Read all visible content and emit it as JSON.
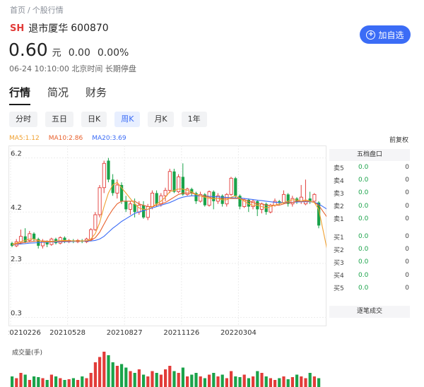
{
  "breadcrumb": {
    "home": "首页",
    "sep": "/",
    "current": "个股行情"
  },
  "stock": {
    "market": "SH",
    "name": "退市厦华",
    "code": "600870",
    "price": "0.60",
    "unit": "元",
    "change": "0.00",
    "change_pct": "0.00%"
  },
  "status": {
    "time": "06-24 10:10:00",
    "zone": "北京时间",
    "state": "长期停盘"
  },
  "watchlist_button": {
    "label": "加自选",
    "icon": "plus-circle-icon"
  },
  "main_tabs": [
    {
      "label": "行情",
      "active": true
    },
    {
      "label": "简况",
      "active": false
    },
    {
      "label": "财务",
      "active": false
    }
  ],
  "period_tabs": [
    {
      "label": "分时",
      "active": false
    },
    {
      "label": "五日",
      "active": false
    },
    {
      "label": "日K",
      "active": false
    },
    {
      "label": "周K",
      "active": true
    },
    {
      "label": "月K",
      "active": false
    },
    {
      "label": "1年",
      "active": false
    }
  ],
  "ma_legend": [
    {
      "label": "MA5:1.12",
      "color": "#f0a030"
    },
    {
      "label": "MA10:2.86",
      "color": "#e8602c"
    },
    {
      "label": "MA20:3.69",
      "color": "#3b6cf6"
    }
  ],
  "fq_label": "前复权",
  "colors": {
    "up": "#e23c39",
    "down": "#1aa34a",
    "accent": "#3b6cf6"
  },
  "order_book": {
    "title": "五档盘口",
    "sells": [
      {
        "label": "卖5",
        "price": "0.0",
        "volume": "0"
      },
      {
        "label": "卖4",
        "price": "0.0",
        "volume": "0"
      },
      {
        "label": "卖3",
        "price": "0.0",
        "volume": "0"
      },
      {
        "label": "卖2",
        "price": "0.0",
        "volume": "0"
      },
      {
        "label": "卖1",
        "price": "0.0",
        "volume": "0"
      }
    ],
    "buys": [
      {
        "label": "买1",
        "price": "0.0",
        "volume": "0"
      },
      {
        "label": "买2",
        "price": "0.0",
        "volume": "0"
      },
      {
        "label": "买3",
        "price": "0.0",
        "volume": "0"
      },
      {
        "label": "买4",
        "price": "0.0",
        "volume": "0"
      },
      {
        "label": "买5",
        "price": "0.0",
        "volume": "0"
      }
    ]
  },
  "trades_title": "逐笔成交",
  "volume_label": "成交量(手)",
  "chart_data": {
    "type": "candlestick",
    "y_ticks": [
      "6.2",
      "4.2",
      "2.3",
      "0.3"
    ],
    "y_tick_values": [
      6.2,
      4.2,
      2.3,
      0.3
    ],
    "ylim": [
      0.0,
      6.4
    ],
    "x_ticks": [
      "20210226",
      "20210528",
      "20210827",
      "20211126",
      "20220304"
    ],
    "x_tick_index": [
      0,
      13,
      26,
      39,
      52
    ],
    "candles": [
      {
        "o": 3.05,
        "c": 2.95,
        "h": 3.1,
        "l": 2.9
      },
      {
        "o": 2.95,
        "c": 3.1,
        "h": 3.2,
        "l": 2.9
      },
      {
        "o": 3.1,
        "c": 3.3,
        "h": 3.55,
        "l": 3.0
      },
      {
        "o": 3.3,
        "c": 3.1,
        "h": 3.6,
        "l": 3.05
      },
      {
        "o": 3.15,
        "c": 3.4,
        "h": 3.5,
        "l": 3.1
      },
      {
        "o": 3.4,
        "c": 3.2,
        "h": 3.45,
        "l": 3.1
      },
      {
        "o": 3.2,
        "c": 2.95,
        "h": 3.25,
        "l": 2.85
      },
      {
        "o": 2.95,
        "c": 3.1,
        "h": 3.2,
        "l": 2.85
      },
      {
        "o": 3.1,
        "c": 3.0,
        "h": 3.15,
        "l": 2.9
      },
      {
        "o": 3.0,
        "c": 3.2,
        "h": 3.25,
        "l": 2.95
      },
      {
        "o": 3.2,
        "c": 3.05,
        "h": 3.25,
        "l": 3.0
      },
      {
        "o": 3.05,
        "c": 3.25,
        "h": 3.3,
        "l": 3.0
      },
      {
        "o": 3.25,
        "c": 3.1,
        "h": 3.3,
        "l": 3.05
      },
      {
        "o": 3.1,
        "c": 3.15,
        "h": 3.2,
        "l": 3.05
      },
      {
        "o": 3.15,
        "c": 3.1,
        "h": 3.2,
        "l": 3.05
      },
      {
        "o": 3.1,
        "c": 3.15,
        "h": 3.2,
        "l": 3.05
      },
      {
        "o": 3.15,
        "c": 3.1,
        "h": 3.2,
        "l": 3.05
      },
      {
        "o": 3.1,
        "c": 3.2,
        "h": 3.25,
        "l": 3.05
      },
      {
        "o": 3.2,
        "c": 3.55,
        "h": 3.6,
        "l": 3.15
      },
      {
        "o": 3.55,
        "c": 4.1,
        "h": 4.2,
        "l": 3.5
      },
      {
        "o": 4.1,
        "c": 5.1,
        "h": 5.2,
        "l": 4.0
      },
      {
        "o": 5.1,
        "c": 6.0,
        "h": 6.1,
        "l": 4.9
      },
      {
        "o": 6.1,
        "c": 5.4,
        "h": 6.2,
        "l": 5.3
      },
      {
        "o": 5.4,
        "c": 4.9,
        "h": 5.6,
        "l": 4.8
      },
      {
        "o": 4.9,
        "c": 5.2,
        "h": 5.4,
        "l": 4.7
      },
      {
        "o": 5.2,
        "c": 4.6,
        "h": 5.3,
        "l": 4.5
      },
      {
        "o": 4.6,
        "c": 4.3,
        "h": 4.8,
        "l": 4.2
      },
      {
        "o": 4.3,
        "c": 4.5,
        "h": 4.6,
        "l": 4.1
      },
      {
        "o": 4.5,
        "c": 4.2,
        "h": 4.7,
        "l": 4.0
      },
      {
        "o": 4.2,
        "c": 4.45,
        "h": 4.6,
        "l": 4.1
      },
      {
        "o": 4.45,
        "c": 4.0,
        "h": 4.6,
        "l": 3.95
      },
      {
        "o": 4.0,
        "c": 4.4,
        "h": 4.5,
        "l": 3.9
      },
      {
        "o": 4.4,
        "c": 4.9,
        "h": 5.0,
        "l": 4.3
      },
      {
        "o": 4.9,
        "c": 4.5,
        "h": 5.0,
        "l": 4.4
      },
      {
        "o": 4.5,
        "c": 4.8,
        "h": 4.9,
        "l": 4.4
      },
      {
        "o": 4.8,
        "c": 5.0,
        "h": 5.1,
        "l": 4.6
      },
      {
        "o": 5.0,
        "c": 5.7,
        "h": 5.8,
        "l": 4.9
      },
      {
        "o": 5.7,
        "c": 4.95,
        "h": 5.8,
        "l": 4.9
      },
      {
        "o": 4.95,
        "c": 5.5,
        "h": 5.6,
        "l": 4.9
      },
      {
        "o": 5.5,
        "c": 4.85,
        "h": 6.0,
        "l": 4.8
      },
      {
        "o": 4.85,
        "c": 5.05,
        "h": 5.1,
        "l": 4.8
      },
      {
        "o": 5.05,
        "c": 4.9,
        "h": 5.1,
        "l": 4.8
      },
      {
        "o": 4.9,
        "c": 4.6,
        "h": 4.95,
        "l": 4.5
      },
      {
        "o": 4.6,
        "c": 4.85,
        "h": 4.95,
        "l": 4.55
      },
      {
        "o": 4.85,
        "c": 4.45,
        "h": 4.9,
        "l": 4.4
      },
      {
        "o": 4.45,
        "c": 4.95,
        "h": 5.0,
        "l": 4.4
      },
      {
        "o": 4.95,
        "c": 4.6,
        "h": 5.0,
        "l": 4.3
      },
      {
        "o": 4.6,
        "c": 4.8,
        "h": 4.9,
        "l": 4.5
      },
      {
        "o": 4.8,
        "c": 4.5,
        "h": 4.85,
        "l": 4.4
      },
      {
        "o": 4.5,
        "c": 4.85,
        "h": 4.9,
        "l": 4.4
      },
      {
        "o": 4.85,
        "c": 5.45,
        "h": 5.5,
        "l": 4.8
      },
      {
        "o": 5.45,
        "c": 4.8,
        "h": 5.5,
        "l": 4.7
      },
      {
        "o": 4.8,
        "c": 4.4,
        "h": 4.85,
        "l": 4.3
      },
      {
        "o": 4.4,
        "c": 4.65,
        "h": 4.7,
        "l": 4.35
      },
      {
        "o": 4.65,
        "c": 4.4,
        "h": 4.7,
        "l": 4.2
      },
      {
        "o": 4.4,
        "c": 4.6,
        "h": 4.65,
        "l": 4.3
      },
      {
        "o": 4.6,
        "c": 4.3,
        "h": 4.65,
        "l": 4.05
      },
      {
        "o": 4.3,
        "c": 4.5,
        "h": 4.55,
        "l": 4.15
      },
      {
        "o": 4.5,
        "c": 4.2,
        "h": 4.55,
        "l": 4.1
      },
      {
        "o": 4.2,
        "c": 4.45,
        "h": 4.5,
        "l": 4.15
      },
      {
        "o": 4.45,
        "c": 4.6,
        "h": 4.7,
        "l": 4.4
      },
      {
        "o": 4.6,
        "c": 4.55,
        "h": 4.65,
        "l": 4.45
      },
      {
        "o": 4.55,
        "c": 4.85,
        "h": 5.0,
        "l": 4.5
      },
      {
        "o": 4.85,
        "c": 4.5,
        "h": 4.9,
        "l": 4.4
      },
      {
        "o": 4.5,
        "c": 4.7,
        "h": 4.8,
        "l": 4.4
      },
      {
        "o": 4.7,
        "c": 4.6,
        "h": 4.75,
        "l": 4.5
      },
      {
        "o": 4.6,
        "c": 4.75,
        "h": 5.2,
        "l": 4.5
      },
      {
        "o": 4.5,
        "c": 4.6,
        "h": 5.4,
        "l": 4.45
      },
      {
        "o": 4.7,
        "c": 4.6,
        "h": 4.95,
        "l": 4.5
      },
      {
        "o": 4.6,
        "c": 4.85,
        "h": 4.9,
        "l": 4.55
      },
      {
        "o": 4.55,
        "c": 3.7,
        "h": 4.6,
        "l": 3.6
      }
    ],
    "tail": [
      {
        "o": 0.25,
        "c": 0.3,
        "h": 0.32,
        "l": 0.24
      },
      {
        "o": 0.3,
        "c": 0.38,
        "h": 0.42,
        "l": 0.28
      },
      {
        "o": 0.38,
        "c": 0.48,
        "h": 0.55,
        "l": 0.36
      },
      {
        "o": 0.48,
        "c": 0.55,
        "h": 0.62,
        "l": 0.45
      },
      {
        "o": 0.5,
        "c": 0.6,
        "h": 0.65,
        "l": 0.48
      }
    ],
    "ma5": [
      3.0,
      3.05,
      3.1,
      3.15,
      3.2,
      3.2,
      3.15,
      3.1,
      3.1,
      3.1,
      3.12,
      3.14,
      3.15,
      3.14,
      3.13,
      3.13,
      3.13,
      3.14,
      3.2,
      3.4,
      3.8,
      4.4,
      4.9,
      5.2,
      5.3,
      5.1,
      4.9,
      4.7,
      4.5,
      4.35,
      4.3,
      4.3,
      4.4,
      4.5,
      4.6,
      4.75,
      4.95,
      5.0,
      5.05,
      5.05,
      5.0,
      4.95,
      4.85,
      4.8,
      4.75,
      4.7,
      4.7,
      4.7,
      4.65,
      4.65,
      4.75,
      4.8,
      4.7,
      4.6,
      4.5,
      4.45,
      4.45,
      4.4,
      4.35,
      4.4,
      4.45,
      4.5,
      4.55,
      4.6,
      4.65,
      4.65,
      4.6,
      4.65,
      4.6,
      4.55,
      4.3,
      2.8,
      1.9,
      1.12
    ],
    "ma10": [
      3.0,
      3.02,
      3.05,
      3.08,
      3.1,
      3.12,
      3.13,
      3.13,
      3.12,
      3.12,
      3.12,
      3.12,
      3.12,
      3.13,
      3.13,
      3.13,
      3.13,
      3.14,
      3.15,
      3.25,
      3.45,
      3.75,
      4.05,
      4.3,
      4.5,
      4.6,
      4.6,
      4.6,
      4.6,
      4.5,
      4.45,
      4.4,
      4.4,
      4.45,
      4.5,
      4.55,
      4.65,
      4.75,
      4.85,
      4.9,
      4.9,
      4.9,
      4.85,
      4.8,
      4.8,
      4.75,
      4.7,
      4.7,
      4.7,
      4.7,
      4.7,
      4.7,
      4.7,
      4.65,
      4.6,
      4.55,
      4.5,
      4.5,
      4.45,
      4.45,
      4.45,
      4.45,
      4.5,
      4.55,
      4.55,
      4.6,
      4.6,
      4.6,
      4.6,
      4.55,
      4.45,
      4.0,
      3.4,
      2.86
    ],
    "ma20": [
      3.0,
      3.01,
      3.02,
      3.03,
      3.05,
      3.06,
      3.07,
      3.08,
      3.08,
      3.09,
      3.09,
      3.1,
      3.1,
      3.11,
      3.11,
      3.12,
      3.12,
      3.12,
      3.13,
      3.15,
      3.2,
      3.3,
      3.45,
      3.6,
      3.72,
      3.85,
      3.95,
      4.05,
      4.15,
      4.2,
      4.25,
      4.3,
      4.35,
      4.4,
      4.45,
      4.5,
      4.55,
      4.62,
      4.7,
      4.75,
      4.78,
      4.8,
      4.8,
      4.8,
      4.8,
      4.78,
      4.77,
      4.76,
      4.75,
      4.74,
      4.73,
      4.72,
      4.72,
      4.7,
      4.68,
      4.66,
      4.64,
      4.62,
      4.6,
      4.58,
      4.56,
      4.55,
      4.55,
      4.55,
      4.56,
      4.57,
      4.58,
      4.58,
      4.58,
      4.56,
      4.5,
      4.3,
      3.95,
      3.69
    ],
    "volume": [
      30,
      25,
      40,
      35,
      20,
      30,
      28,
      25,
      20,
      35,
      30,
      25,
      20,
      22,
      25,
      20,
      30,
      25,
      40,
      70,
      85,
      100,
      90,
      70,
      60,
      65,
      55,
      45,
      40,
      50,
      35,
      30,
      45,
      40,
      35,
      50,
      60,
      45,
      40,
      55,
      30,
      35,
      40,
      30,
      25,
      35,
      40,
      30,
      35,
      25,
      45,
      30,
      28,
      35,
      25,
      30,
      45,
      40,
      30,
      25,
      20,
      25,
      30,
      22,
      28,
      35,
      30,
      25,
      40,
      30,
      25,
      100,
      70,
      40
    ]
  }
}
